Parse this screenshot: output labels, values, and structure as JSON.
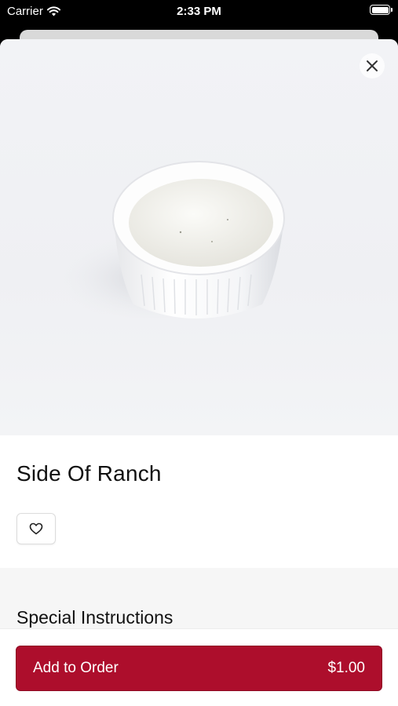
{
  "status_bar": {
    "carrier": "Carrier",
    "time": "2:33 PM",
    "wifi_icon": "wifi-icon",
    "battery_icon": "battery-icon"
  },
  "item": {
    "name": "Side Of Ranch",
    "image_subject": "ramekin of ranch dressing",
    "close_icon": "close-icon",
    "favorite_icon": "heart-icon"
  },
  "special_instructions": {
    "title": "Special Instructions"
  },
  "footer": {
    "add_label": "Add to Order",
    "price": "$1.00"
  },
  "colors": {
    "accent": "#ad0e2c",
    "section_background": "#f6f6f6"
  }
}
